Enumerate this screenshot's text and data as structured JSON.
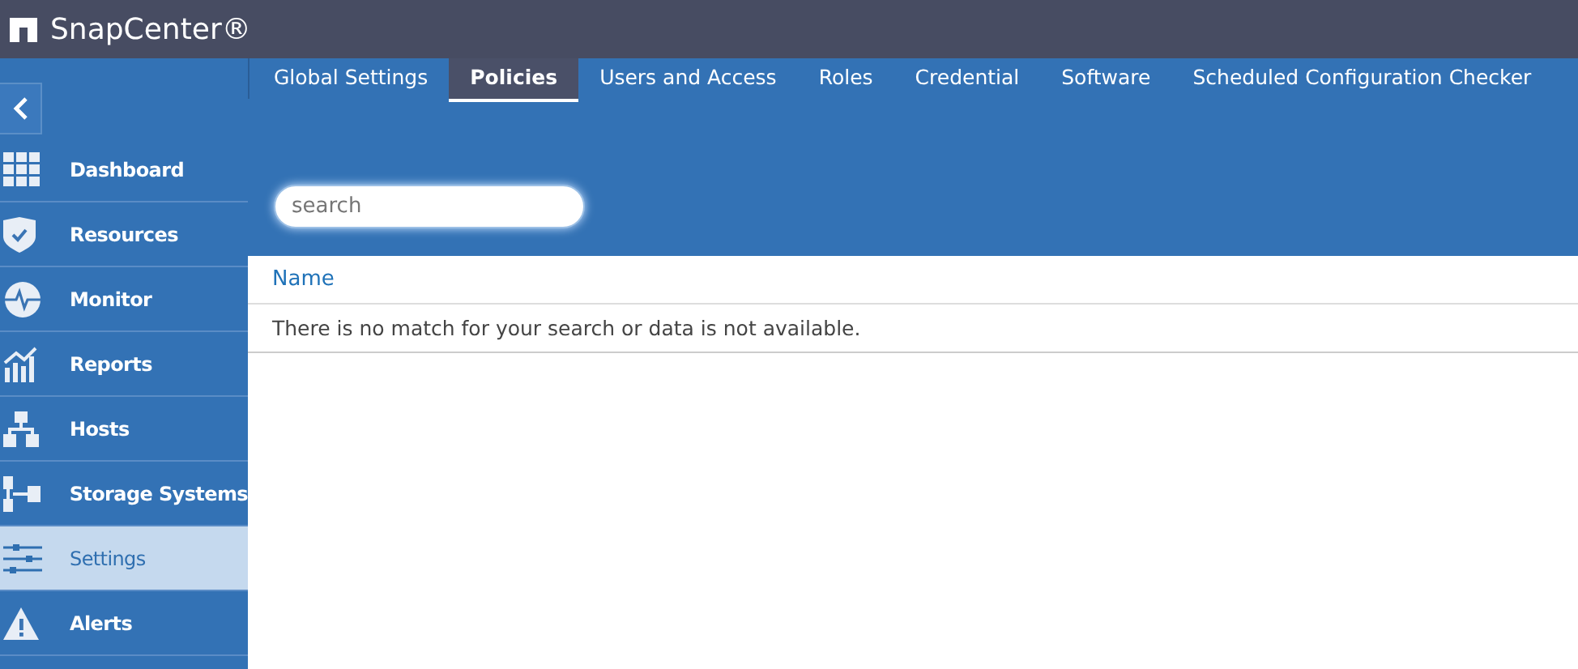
{
  "app": {
    "title": "SnapCenter®"
  },
  "sidebar": {
    "items": [
      {
        "label": "Dashboard",
        "selected": false
      },
      {
        "label": "Resources",
        "selected": false
      },
      {
        "label": "Monitor",
        "selected": false
      },
      {
        "label": "Reports",
        "selected": false
      },
      {
        "label": "Hosts",
        "selected": false
      },
      {
        "label": "Storage Systems",
        "selected": false
      },
      {
        "label": "Settings",
        "selected": true
      },
      {
        "label": "Alerts",
        "selected": false
      }
    ]
  },
  "tabs": [
    {
      "label": "Global Settings",
      "selected": false
    },
    {
      "label": "Policies",
      "selected": true
    },
    {
      "label": "Users and Access",
      "selected": false
    },
    {
      "label": "Roles",
      "selected": false
    },
    {
      "label": "Credential",
      "selected": false
    },
    {
      "label": "Software",
      "selected": false
    },
    {
      "label": "Scheduled Configuration Checker",
      "selected": false
    }
  ],
  "search": {
    "placeholder": "search"
  },
  "table": {
    "columns": [
      "Name"
    ],
    "empty_message": "There is no match for your search or data is not available."
  }
}
